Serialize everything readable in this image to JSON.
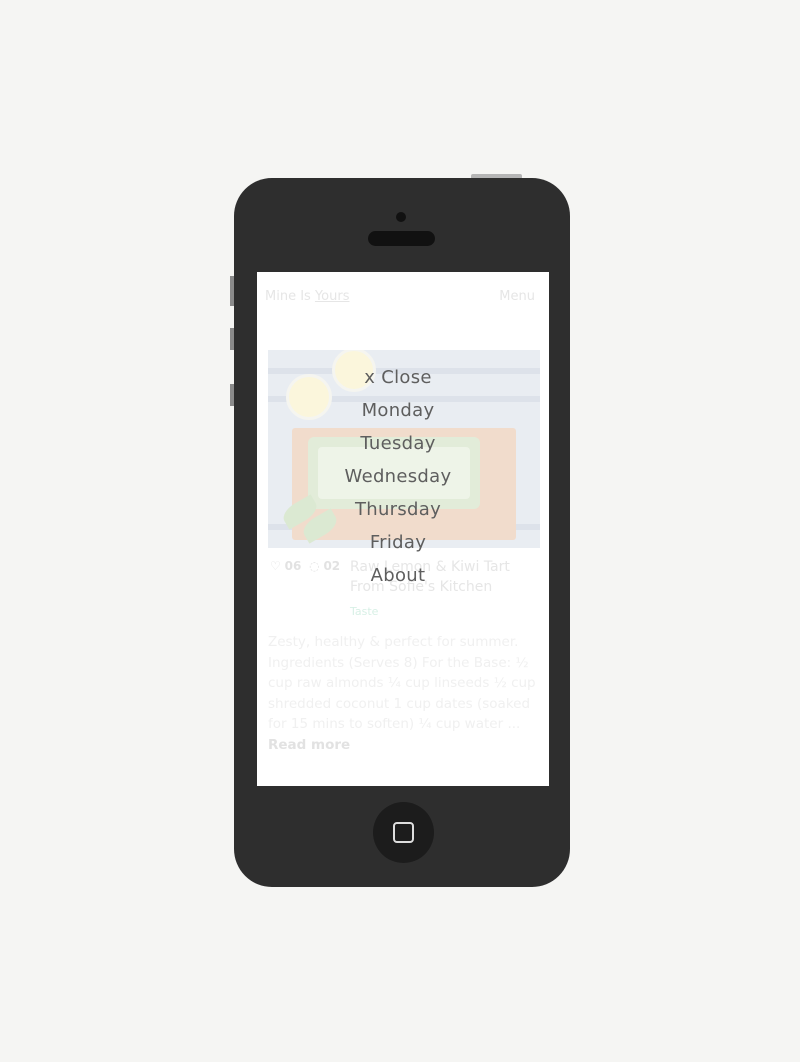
{
  "site": {
    "brand_prefix": "Mine Is ",
    "brand_link": "Yours",
    "menu_link": "Menu"
  },
  "post": {
    "stats_a": "06",
    "stats_b": "02",
    "title": "Raw Lemon & Kiwi Tart From Sofie's Kitchen",
    "tag": "Taste",
    "excerpt": "Zesty, healthy & perfect for summer. Ingredients (Serves 8) For the Base: ½ cup raw almonds ¼ cup linseeds ½ cup shredded coconut 1 cup dates (soaked for 15 mins to soften) ¼ cup water ... ",
    "read_more": "Read more"
  },
  "nav": {
    "items": [
      "x Close",
      "Monday",
      "Tuesday",
      "Wednesday",
      "Thursday",
      "Friday",
      "About"
    ]
  }
}
